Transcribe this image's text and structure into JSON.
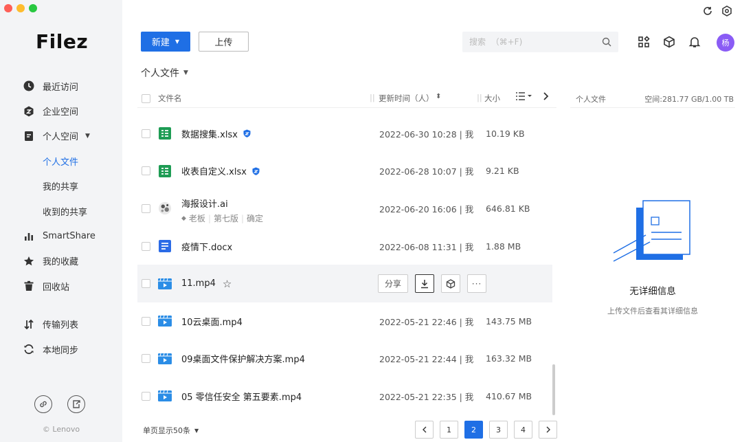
{
  "brand": {
    "name": "Filez",
    "copyright": "© Lenovo",
    "accent": "#1f6fe5"
  },
  "sidebar": {
    "items": [
      {
        "label": "最近访问",
        "icon": "clock-icon"
      },
      {
        "label": "企业空间",
        "icon": "enterprise-icon"
      },
      {
        "label": "个人空间",
        "icon": "document-icon"
      },
      {
        "label": "个人文件"
      },
      {
        "label": "我的共享"
      },
      {
        "label": "收到的共享"
      },
      {
        "label": "SmartShare",
        "icon": "bar-chart-icon"
      },
      {
        "label": "我的收藏",
        "icon": "star-icon"
      },
      {
        "label": "回收站",
        "icon": "trash-icon"
      },
      {
        "label": "传输列表",
        "icon": "transfer-icon"
      },
      {
        "label": "本地同步",
        "icon": "sync-icon"
      }
    ]
  },
  "toolbar": {
    "new_label": "新建",
    "upload_label": "上传",
    "search_placeholder": "搜索  （⌘+F)",
    "avatar_text": "杨"
  },
  "breadcrumb": {
    "label": "个人文件"
  },
  "table": {
    "col_name": "文件名",
    "col_time": "更新时间（人）",
    "col_size": "大小",
    "rows": [
      {
        "name": "数据搜集.xlsx",
        "time": "2022-06-30 10:28 | 我",
        "size": "10.19 KB",
        "type": "xlsx"
      },
      {
        "name": "收表自定义.xlsx",
        "time": "2022-06-28 10:07 | 我",
        "size": "9.21 KB",
        "type": "xlsx"
      },
      {
        "name": "海报设计.ai",
        "time": "2022-06-20 16:06 | 我",
        "size": "646.81 KB",
        "type": "ai",
        "tags": [
          "老板",
          "第七版",
          "确定"
        ]
      },
      {
        "name": "疫情下.docx",
        "time": "2022-06-08 11:31 | 我",
        "size": "1.88 MB",
        "type": "docx"
      },
      {
        "name": "11.mp4",
        "time": "",
        "size": "",
        "type": "mp4"
      },
      {
        "name": "10云桌面.mp4",
        "time": "2022-05-21 22:46 | 我",
        "size": "143.75 MB",
        "type": "mp4"
      },
      {
        "name": "09桌面文件保护解决方案.mp4",
        "time": "2022-05-21 22:44 | 我",
        "size": "163.32 MB",
        "type": "mp4"
      },
      {
        "name": "05 零信任安全 第五要素.mp4",
        "time": "2022-05-21 22:35 | 我",
        "size": "410.67 MB",
        "type": "mp4"
      }
    ],
    "hover_share_label": "分享"
  },
  "footer": {
    "page_size_label": "单页显示50条",
    "pages": [
      "1",
      "2",
      "3",
      "4"
    ],
    "current_page": "2"
  },
  "detail": {
    "header_left": "个人文件",
    "header_right": "空间:281.77 GB/1.00 TB",
    "empty_title": "无详细信息",
    "empty_desc": "上传文件后查看其详细信息"
  }
}
